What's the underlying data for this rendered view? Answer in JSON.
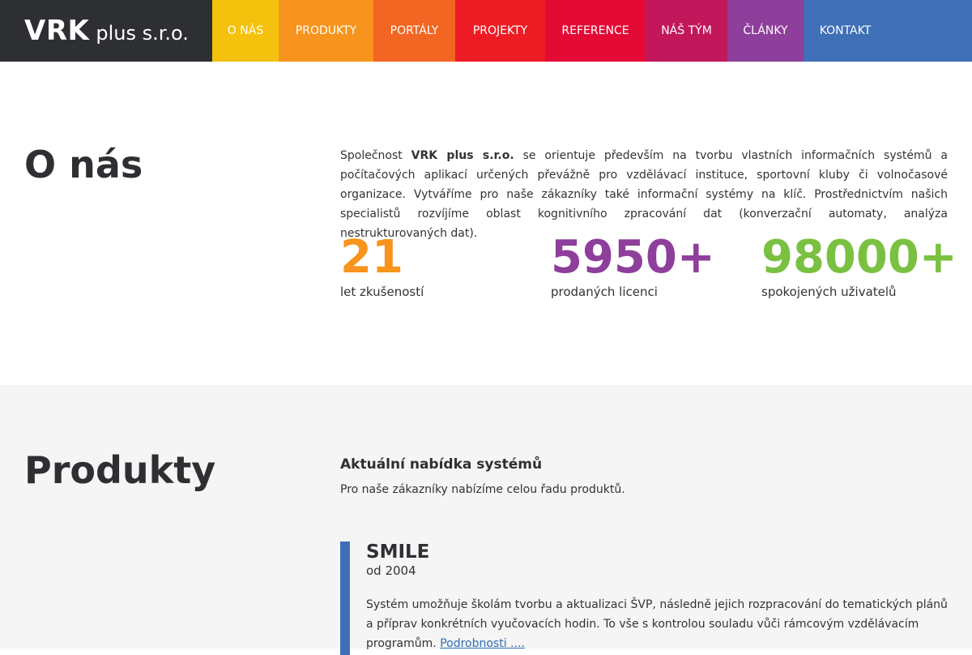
{
  "brand": {
    "bold": "VRK",
    "light": "plus s.r.o."
  },
  "nav": {
    "items": [
      {
        "label": "O NÁS",
        "color": "#f4c20d"
      },
      {
        "label": "PRODUKTY",
        "color": "#f7941d"
      },
      {
        "label": "PORTÁLY",
        "color": "#f26522"
      },
      {
        "label": "PROJEKTY",
        "color": "#ed1c24"
      },
      {
        "label": "REFERENCE",
        "color": "#e30b35"
      },
      {
        "label": "NÁŠ TÝM",
        "color": "#c2185b"
      },
      {
        "label": "ČLÁNKY",
        "color": "#8e3e9b"
      },
      {
        "label": "KONTAKT",
        "color": "#3e6fb7"
      }
    ]
  },
  "about": {
    "title": "O nás",
    "text_prefix": "Společnost",
    "company": "VRK plus s.r.o.",
    "text_rest": "se orientuje především na tvorbu vlastních informačních systémů a počítačových aplikací určených převážně pro vzdělávací instituce, sportovní kluby či volnočasové organizace. Vytváříme pro naše zákazníky také informační systémy na klíč. Prostřednictvím našich specialistů rozvíjíme oblast kognitivního zpracování dat (konverzační automaty, analýza nestrukturovaných dat).",
    "stats": [
      {
        "value": "21",
        "label": "let zkušeností",
        "color": "#f7941d"
      },
      {
        "value": "5950+",
        "label": "prodaných licenci",
        "color": "#8e3e9b"
      },
      {
        "value": "98000+",
        "label": "spokojených uživatelů",
        "color": "#7ac142"
      }
    ]
  },
  "products": {
    "title": "Produkty",
    "heading": "Aktuální nabídka systémů",
    "subtitle": "Pro naše zákazníky nabízíme celou řadu produktů.",
    "item": {
      "name": "SMILE",
      "since": "od 2004",
      "description": "Systém umožňuje školám tvorbu a aktualizaci ŠVP, následně jejich rozpracování do tematických plánů a příprav konkrétních vyučovacích hodin. To vše s kontrolou souladu vůči rámcovým vzdělávacím programům.",
      "link": "Podrobnosti ....",
      "bar_color": "#3e6fb7"
    }
  }
}
